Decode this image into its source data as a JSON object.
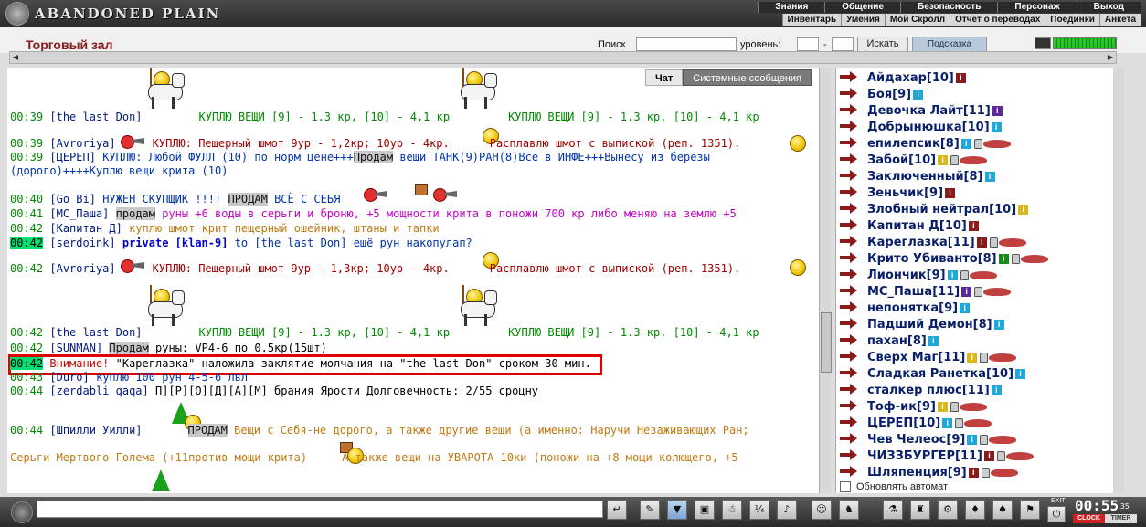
{
  "app": {
    "logo_text": "ABANDONED PLAIN"
  },
  "nav_primary": [
    "Знания",
    "Общение",
    "Безопасность",
    "Персонаж",
    "Выход"
  ],
  "nav_secondary": [
    "Инвентарь",
    "Умения",
    "Мой Скролл",
    "Отчет о переводах",
    "Поединки",
    "Анкета"
  ],
  "header": {
    "title": "Торговый зал",
    "search_label": "Поиск",
    "level_label": "уровень:",
    "dash": "-",
    "search_button": "Искать",
    "hint_button": "Подсказка",
    "health_fraction": 1.0
  },
  "chat": {
    "tabs": [
      "Чат",
      "Системные сообщения"
    ],
    "messages": [
      {
        "time": "00:39",
        "name": "the last Don",
        "text": "КУПЛЮ ВЕЩИ [9] - 1.3 кр, [10] - 4,1 кр",
        "text2": "КУПЛЮ ВЕЩИ [9] - 1.3 кр, [10] - 4,1 кр"
      },
      {
        "time": "00:39",
        "name": "Avroriya",
        "text": "КУПЛЮ: Пещерный шмот 9ур - 1,2кр; 10ур - 4кр.",
        "text2": "Расплавлю шмот с выпиской (реп. 1351)."
      },
      {
        "time": "00:39",
        "name": "ЦЕРЕП",
        "text": "КУПЛЮ: Любой ФУЛЛ (10) по норм цене+++",
        "tag": "Продам",
        "text2": "вещи ТАНК(9)РАН(8)Все в ИНФЕ+++Вынесу из березы",
        "text3": "(дорого)++++Куплю вещи крита (10)"
      },
      {
        "time": "00:40",
        "name": "Go Bi",
        "text": "НУЖЕН СКУПЩИК !!!!",
        "tag": "ПРОДАМ",
        "text2": "ВСЁ С СЕБЯ"
      },
      {
        "time": "00:41",
        "name": "MC_Паша",
        "tag": "продам",
        "text": "руны +6 воды в серьги и броню, +5 мощности крита в поножи 700 кр либо меняю на землю +5"
      },
      {
        "time": "00:42",
        "name": "Капитан Д",
        "text": "куплю шмот крит пещерный ошейник, штаны и тапки"
      },
      {
        "time": "00:42",
        "name": "serdoink",
        "private": "private [klan-9]",
        "text": "to [the last Don] ещё рун накопулап?"
      },
      {
        "time": "00:42",
        "name": "Avroriya",
        "text": "КУПЛЮ: Пещерный шмот 9ур - 1,3кр; 10ур - 4кр.",
        "text2": "Расплавлю шмот с выпиской (реп. 1351)."
      },
      {
        "time": "00:42",
        "name": "the last Don",
        "text": "КУПЛЮ ВЕЩИ [9] - 1.3 кр, [10] - 4,1 кр",
        "text2": "КУПЛЮ ВЕЩИ [9] - 1.3 кр, [10] - 4,1 кр"
      },
      {
        "time": "00:42",
        "name": "SUNMAN",
        "tag": "Продам",
        "text": "руны: VP4-6 по 0.5кр(15шт)"
      },
      {
        "time": "00:42",
        "warning": "Внимание!",
        "text": "\"Кареглазка\" наложила заклятие молчания на \"the last Don\" сроком 30 мин."
      },
      {
        "time": "00:43",
        "name": "Duro",
        "text": "куплю 100 рун 4-5-6 лвл"
      },
      {
        "time": "00:44",
        "name": "zerdabli qaqa",
        "text": "П][Р][О][Д][А][М] брания Ярости Долговечность: 2/55 сроцну"
      },
      {
        "time": "00:44",
        "name": "Шпилли Уилли",
        "tag": "ПРОДАМ",
        "text": "Вещи с Себя-не дорого, а также другие вещи (а именно: Наручи Незаживающих Ран;"
      },
      {
        "text": "Серьги Мертвого Голема (+11против мощи крита)",
        "text2": "А также вещи на УВАРОТА 10ки (поножи на +8 мощи колющего, +5"
      }
    ]
  },
  "users": [
    {
      "name": "Айдахар[10]",
      "badge": "darkred"
    },
    {
      "name": "Боя[9]",
      "badge": "cyan"
    },
    {
      "name": "Девочка Лайт[11]",
      "badge": "purple"
    },
    {
      "name": "Добрынюшка[10]",
      "badge": "cyan"
    },
    {
      "name": "епилепсик[8]",
      "badge": "cyan"
    },
    {
      "name": "Забой[10]",
      "badge": "yellow"
    },
    {
      "name": "Заключенный[8]",
      "badge": "cyan"
    },
    {
      "name": "Зеньчик[9]",
      "badge": "darkred"
    },
    {
      "name": "Злобный нейтрал[10]",
      "badge": "yellow"
    },
    {
      "name": "Капитан Д[10]",
      "badge": "darkred"
    },
    {
      "name": "Кареглазка[11]",
      "badge": "darkred"
    },
    {
      "name": "Крито Убиванто[8]",
      "badge": "green"
    },
    {
      "name": "Лиончик[9]",
      "badge": "cyan"
    },
    {
      "name": "МС_Паша[11]",
      "badge": "purple"
    },
    {
      "name": "непонятка[9]",
      "badge": "cyan"
    },
    {
      "name": "Падший Демон[8]",
      "badge": "cyan"
    },
    {
      "name": "пахан[8]",
      "badge": "cyan"
    },
    {
      "name": "Сверх Маг[11]",
      "badge": "yellow"
    },
    {
      "name": "Сладкая Ранетка[10]",
      "badge": "cyan"
    },
    {
      "name": "сталкер плюс[11]",
      "badge": "cyan"
    },
    {
      "name": "Тоф-ик[9]",
      "badge": "yellow"
    },
    {
      "name": "ЦЕРЕП[10]",
      "badge": "cyan"
    },
    {
      "name": "Чев Челеос[9]",
      "badge": "cyan"
    },
    {
      "name": "ЧИЗЗБУРГЕР[11]",
      "badge": "darkred"
    },
    {
      "name": "Шляпенция[9]",
      "badge": "darkred"
    }
  ],
  "autoupdate_label": "Обновлять автомат",
  "clock": {
    "time": "00:55",
    "sec": "35",
    "clock_label": "CLOCK",
    "timer_label": "TIMER",
    "exit_label": "EXIT"
  }
}
